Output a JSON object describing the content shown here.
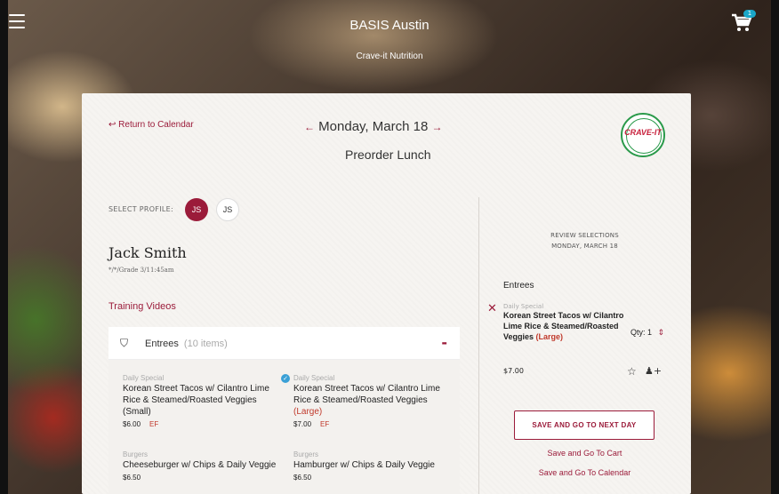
{
  "header": {
    "title": "BASIS Austin",
    "subtitle": "Crave-it Nutrition",
    "cart_count": "1"
  },
  "nav": {
    "return_label": "Return to Calendar",
    "date": "Monday, March 18",
    "page_title": "Preorder Lunch"
  },
  "logo": {
    "text": "CRAVE-IT"
  },
  "profile": {
    "select_label": "SELECT PROFILE:",
    "profiles": [
      "JS",
      "JS"
    ],
    "name": "Jack Smith",
    "details": "*/*/Grade 3/11:45am"
  },
  "training_label": "Training Videos",
  "menu": {
    "category": "Entrees",
    "count": "(10 items)",
    "collapse": "-",
    "items": [
      {
        "category": "Daily Special",
        "name": "Korean Street Tacos w/ Cilantro Lime Rice & Steamed/Roasted Veggies",
        "size": "(Small)",
        "price": "$6.00",
        "tag": "EF"
      },
      {
        "category": "Daily Special",
        "name": "Korean Street Tacos w/ Cilantro Lime Rice & Steamed/Roasted Veggies",
        "size": "(Large)",
        "price": "$7.00",
        "tag": "EF"
      },
      {
        "category": "Burgers",
        "name": "Cheeseburger w/ Chips & Daily Veggie",
        "price": "$6.50"
      },
      {
        "category": "Burgers",
        "name": "Hamburger w/ Chips & Daily Veggie",
        "price": "$6.50"
      }
    ]
  },
  "review": {
    "title_line1": "REVIEW SELECTIONS",
    "title_line2": "MONDAY, MARCH 18",
    "section": "Entrees",
    "item": {
      "category": "Daily Special",
      "name": "Korean Street Tacos w/ Cilantro Lime Rice & Steamed/Roasted Veggies",
      "size": "(Large)",
      "price": "$7.00",
      "qty_label": "Qty:",
      "qty": "1"
    },
    "save_next": "SAVE AND GO TO NEXT DAY",
    "save_cart": "Save and Go To Cart",
    "save_calendar": "Save and Go To Calendar"
  },
  "colors": {
    "accent": "#9b1b3a",
    "badge": "#1aa7c8",
    "tag": "#c0392b",
    "check": "#3aa0d6"
  },
  "icons": [
    "menu-icon",
    "cart-icon",
    "back-arrow-icon",
    "prev-arrow-icon",
    "next-arrow-icon",
    "shield-icon",
    "check-icon",
    "remove-icon",
    "qty-stepper-icon",
    "star-icon",
    "add-user-icon"
  ]
}
